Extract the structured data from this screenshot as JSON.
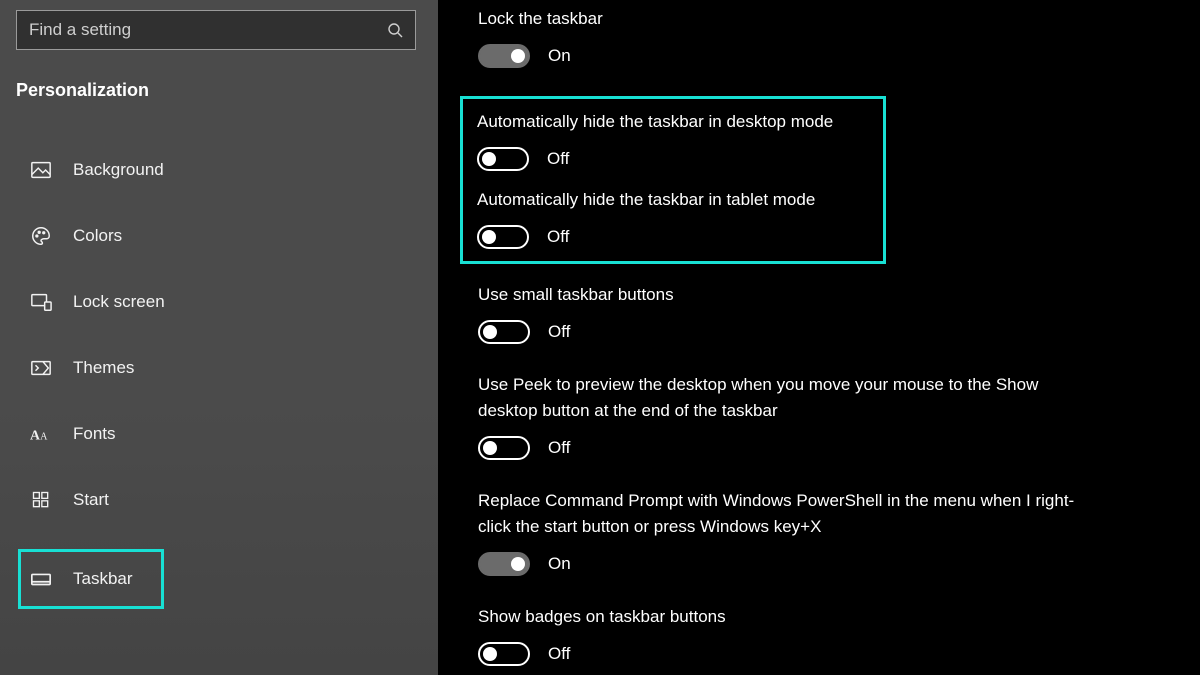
{
  "colors": {
    "highlight": "#18e0d4"
  },
  "search": {
    "placeholder": "Find a setting"
  },
  "category": "Personalization",
  "sidebar": {
    "items": [
      {
        "label": "Background",
        "icon": "image-icon"
      },
      {
        "label": "Colors",
        "icon": "palette-icon"
      },
      {
        "label": "Lock screen",
        "icon": "lockscreen-icon"
      },
      {
        "label": "Themes",
        "icon": "themes-icon"
      },
      {
        "label": "Fonts",
        "icon": "fonts-icon"
      },
      {
        "label": "Start",
        "icon": "start-icon"
      },
      {
        "label": "Taskbar",
        "icon": "taskbar-icon"
      }
    ]
  },
  "toggle_states": {
    "on": "On",
    "off": "Off"
  },
  "settings": [
    {
      "label": "Lock the taskbar",
      "value": "on"
    },
    {
      "label": "Automatically hide the taskbar in desktop mode",
      "value": "off",
      "highlight": true
    },
    {
      "label": "Automatically hide the taskbar in tablet mode",
      "value": "off",
      "highlight": true
    },
    {
      "label": "Use small taskbar buttons",
      "value": "off"
    },
    {
      "label": "Use Peek to preview the desktop when you move your mouse to the Show desktop button at the end of the taskbar",
      "value": "off"
    },
    {
      "label": "Replace Command Prompt with Windows PowerShell in the menu when I right-click the start button or press Windows key+X",
      "value": "on"
    },
    {
      "label": "Show badges on taskbar buttons",
      "value": "off"
    }
  ]
}
